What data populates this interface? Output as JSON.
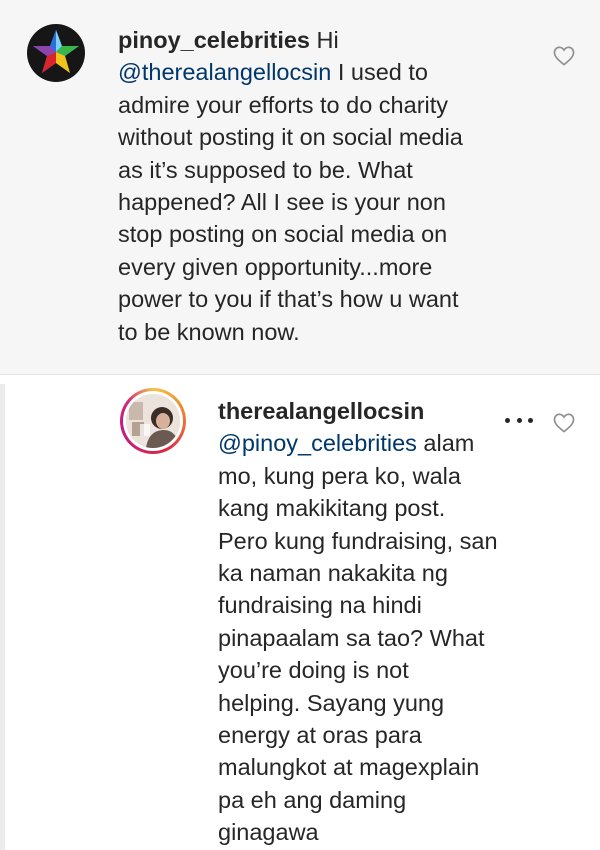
{
  "comments": [
    {
      "username": "pinoy_celebrities",
      "lines": [
        {
          "pre": "",
          "mention": "",
          "post": "Hi"
        },
        {
          "pre": "",
          "mention": "@therealangellocsin",
          "post": " I used to"
        },
        {
          "pre": "admire your efforts to do charity",
          "mention": "",
          "post": ""
        },
        {
          "pre": "without posting it on social media",
          "mention": "",
          "post": ""
        },
        {
          "pre": "as it’s supposed to be. What",
          "mention": "",
          "post": ""
        },
        {
          "pre": "happened? All I see is your non",
          "mention": "",
          "post": ""
        },
        {
          "pre": "stop posting on social media on",
          "mention": "",
          "post": ""
        },
        {
          "pre": "every given opportunity...more",
          "mention": "",
          "post": ""
        },
        {
          "pre": "power to you if that’s how u want",
          "mention": "",
          "post": ""
        },
        {
          "pre": "to be known now.",
          "mention": "",
          "post": ""
        }
      ],
      "avatar_icon": "star-logo-icon",
      "like_icon": "heart-outline-icon"
    },
    {
      "username": "therealangellocsin",
      "lines": [
        {
          "pre": "",
          "mention": "@pinoy_celebrities",
          "post": " alam"
        },
        {
          "pre": "mo, kung pera ko, wala",
          "mention": "",
          "post": ""
        },
        {
          "pre": "kang makikitang post.",
          "mention": "",
          "post": ""
        },
        {
          "pre": "Pero kung fundraising, san",
          "mention": "",
          "post": ""
        },
        {
          "pre": "ka naman nakakita ng",
          "mention": "",
          "post": ""
        },
        {
          "pre": "fundraising na hindi",
          "mention": "",
          "post": ""
        },
        {
          "pre": "pinapaalam sa tao? What",
          "mention": "",
          "post": ""
        },
        {
          "pre": "you’re doing is not",
          "mention": "",
          "post": ""
        },
        {
          "pre": "helping. Sayang yung",
          "mention": "",
          "post": ""
        },
        {
          "pre": "energy at oras para",
          "mention": "",
          "post": ""
        },
        {
          "pre": "malungkot at magexplain",
          "mention": "",
          "post": ""
        },
        {
          "pre": "pa eh ang daming",
          "mention": "",
          "post": ""
        },
        {
          "pre": "ginagawa",
          "mention": "",
          "post": ""
        }
      ],
      "avatar_icon": "profile-photo",
      "more_icon": "more-options-icon",
      "like_icon": "heart-outline-icon"
    }
  ],
  "colors": {
    "text": "#262626",
    "mention": "#00376b",
    "highlight_background": "#f6f6f6",
    "story_ring": [
      "#f7c34a",
      "#dc2743",
      "#bc1888"
    ]
  }
}
